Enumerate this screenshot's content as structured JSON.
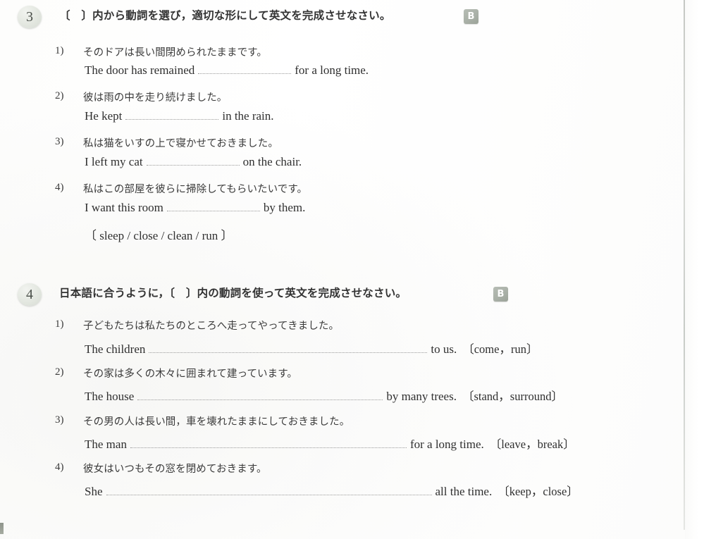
{
  "page": {
    "background_color": "#ffffff",
    "text_color": "#3a3a3a",
    "badge_color": "#a8afa6",
    "number_circle_color": "#e3e7e0"
  },
  "sections": [
    {
      "number": "3",
      "badge": "B",
      "title": "〔　〕内から動詞を選び，適切な形にして英文を完成させなさい。",
      "items": [
        {
          "num": "1)",
          "japanese": "そのドアは長い間閉められたままです。",
          "english_before": "The door has remained",
          "english_after": "for a long time."
        },
        {
          "num": "2)",
          "japanese": "彼は雨の中を走り続けました。",
          "english_before": "He kept",
          "english_after": "in the rain."
        },
        {
          "num": "3)",
          "japanese": "私は猫をいすの上で寝かせておきました。",
          "english_before": "I left my cat",
          "english_after": "on the chair."
        },
        {
          "num": "4)",
          "japanese": "私はこの部屋を彼らに掃除してもらいたいです。",
          "english_before": "I want this room",
          "english_after": "by them."
        }
      ],
      "word_bank": "〔 sleep / close / clean / run 〕"
    },
    {
      "number": "4",
      "badge": "B",
      "title": "日本語に合うように，〔　〕内の動詞を使って英文を完成させなさい。",
      "items": [
        {
          "num": "1)",
          "japanese": "子どもたちは私たちのところへ走ってやってきました。",
          "english_before": "The children",
          "english_after": "to us.",
          "hint": "〔come，run〕"
        },
        {
          "num": "2)",
          "japanese": "その家は多くの木々に囲まれて建っています。",
          "english_before": "The house",
          "english_after": "by many trees.",
          "hint": "〔stand，surround〕"
        },
        {
          "num": "3)",
          "japanese": "その男の人は長い間，車を壊れたままにしておきました。",
          "english_before": "The man",
          "english_after": "for a long time.",
          "hint": "〔leave，break〕"
        },
        {
          "num": "4)",
          "japanese": "彼女はいつもその窓を閉めておきます。",
          "english_before": "She",
          "english_after": "all the time.",
          "hint": "〔keep，close〕"
        }
      ]
    }
  ]
}
